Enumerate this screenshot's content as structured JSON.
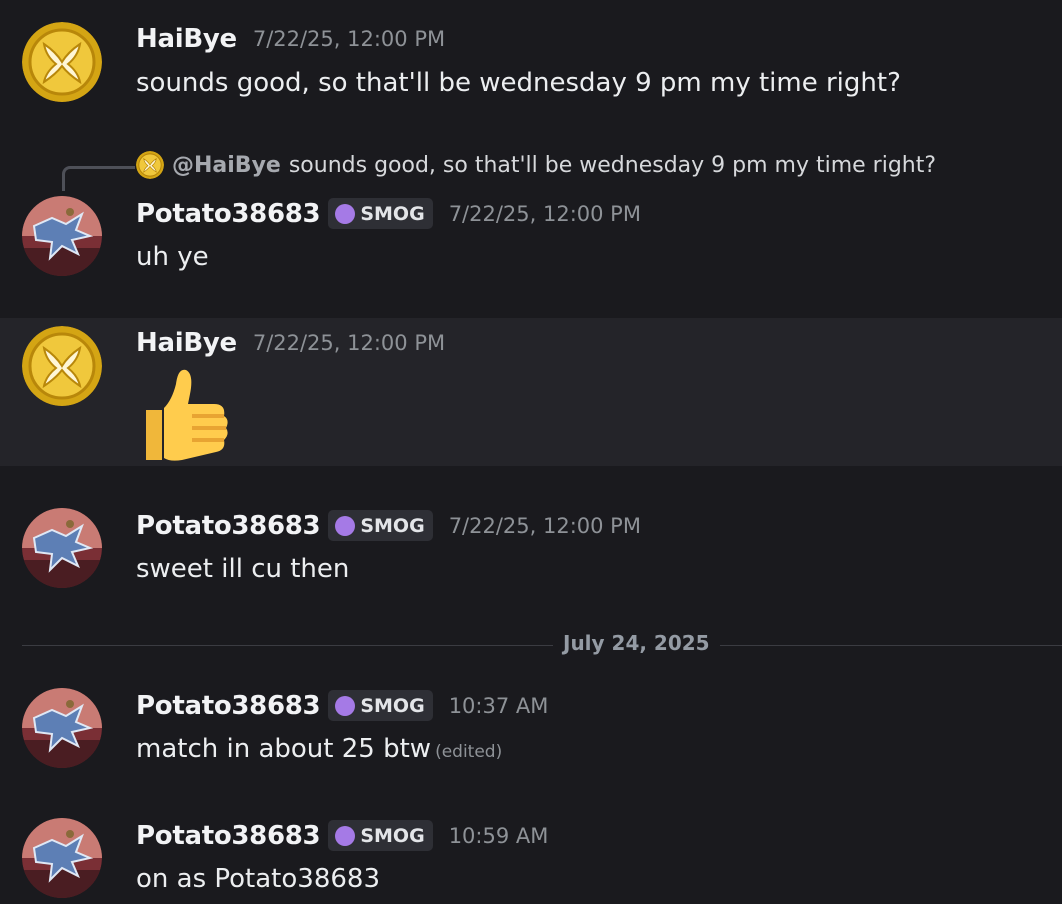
{
  "messages": [
    {
      "author": "HaiBye",
      "timestamp": "7/22/25, 12:00 PM",
      "text": "sounds good, so that'll be wednesday 9 pm my time right?"
    },
    {
      "reply_to": {
        "mention": "@HaiBye",
        "text": "sounds good, so that'll be wednesday 9 pm my time right?"
      },
      "author": "Potato38683",
      "tag": "SMOG",
      "timestamp": "7/22/25, 12:00 PM",
      "text": "uh ye"
    },
    {
      "author": "HaiBye",
      "timestamp": "7/22/25, 12:00 PM",
      "emoji": "thumbs-up"
    },
    {
      "author": "Potato38683",
      "tag": "SMOG",
      "timestamp": "7/22/25, 12:00 PM",
      "text": "sweet ill cu then"
    },
    {
      "author": "Potato38683",
      "tag": "SMOG",
      "timestamp": "10:37 AM",
      "text": "match in about 25 btw",
      "edited_label": "(edited)"
    },
    {
      "author": "Potato38683",
      "tag": "SMOG",
      "timestamp": "10:59 AM",
      "text": "on as Potato38683"
    }
  ],
  "date_divider": "July 24, 2025",
  "colors": {
    "background": "#1a1a1e",
    "highlight": "#242429",
    "timestamp": "#8e9297",
    "tag_bg": "#2e2f35",
    "tag_icon": "#a57ae6"
  }
}
